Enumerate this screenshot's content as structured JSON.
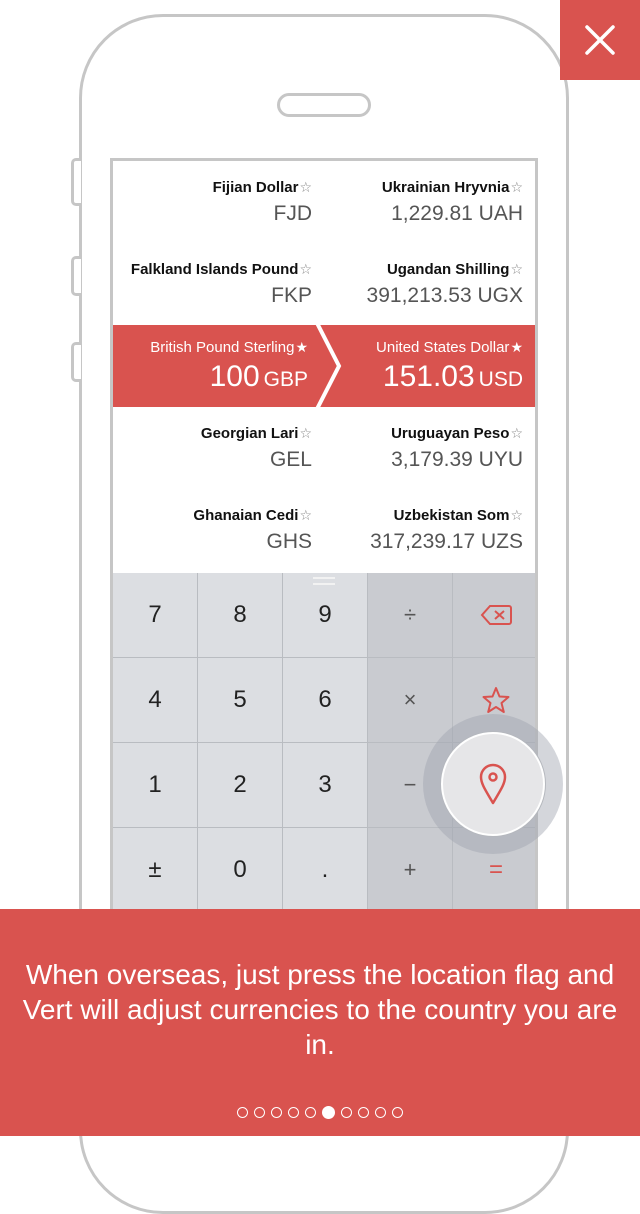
{
  "colors": {
    "accent": "#d9534f",
    "keypad": "#dcdee2",
    "operator": "#c9cbd0"
  },
  "close_button": {
    "icon": "close-icon"
  },
  "rows": [
    {
      "left": {
        "name": "Fijian Dollar",
        "star": "☆",
        "value": "FJD"
      },
      "right": {
        "name": "Ukrainian Hryvnia",
        "star": "☆",
        "value": "1,229.81 UAH"
      }
    },
    {
      "left": {
        "name": "Falkland Islands Pound",
        "star": "☆",
        "value": "FKP"
      },
      "right": {
        "name": "Ugandan Shilling",
        "star": "☆",
        "value": "391,213.53 UGX"
      }
    },
    {
      "left": {
        "name": "British Pound Sterling",
        "star": "★",
        "amount": "100",
        "code": "GBP"
      },
      "right": {
        "name": "United States Dollar",
        "star": "★",
        "amount": "151.03",
        "code": "USD"
      }
    },
    {
      "left": {
        "name": "Georgian Lari",
        "star": "☆",
        "value": "GEL"
      },
      "right": {
        "name": "Uruguayan Peso",
        "star": "☆",
        "value": "3,179.39 UYU"
      }
    },
    {
      "left": {
        "name": "Ghanaian Cedi",
        "star": "☆",
        "value": "GHS"
      },
      "right": {
        "name": "Uzbekistan Som",
        "star": "☆",
        "value": "317,239.17 UZS"
      }
    }
  ],
  "keypad": {
    "k7": "7",
    "k8": "8",
    "k9": "9",
    "divide": "÷",
    "k4": "4",
    "k5": "5",
    "k6": "6",
    "multiply": "×",
    "k1": "1",
    "k2": "2",
    "k3": "3",
    "minus": "−",
    "plusminus": "±",
    "k0": "0",
    "dot": ".",
    "plus": "+",
    "equals": "=",
    "backspace_icon": "backspace-icon",
    "favorite_icon": "star-icon",
    "location_icon": "location-pin-icon"
  },
  "caption": "When overseas, just press the location flag and Vert will adjust currencies to the country you are in.",
  "pager": {
    "count": 10,
    "active": 5
  }
}
